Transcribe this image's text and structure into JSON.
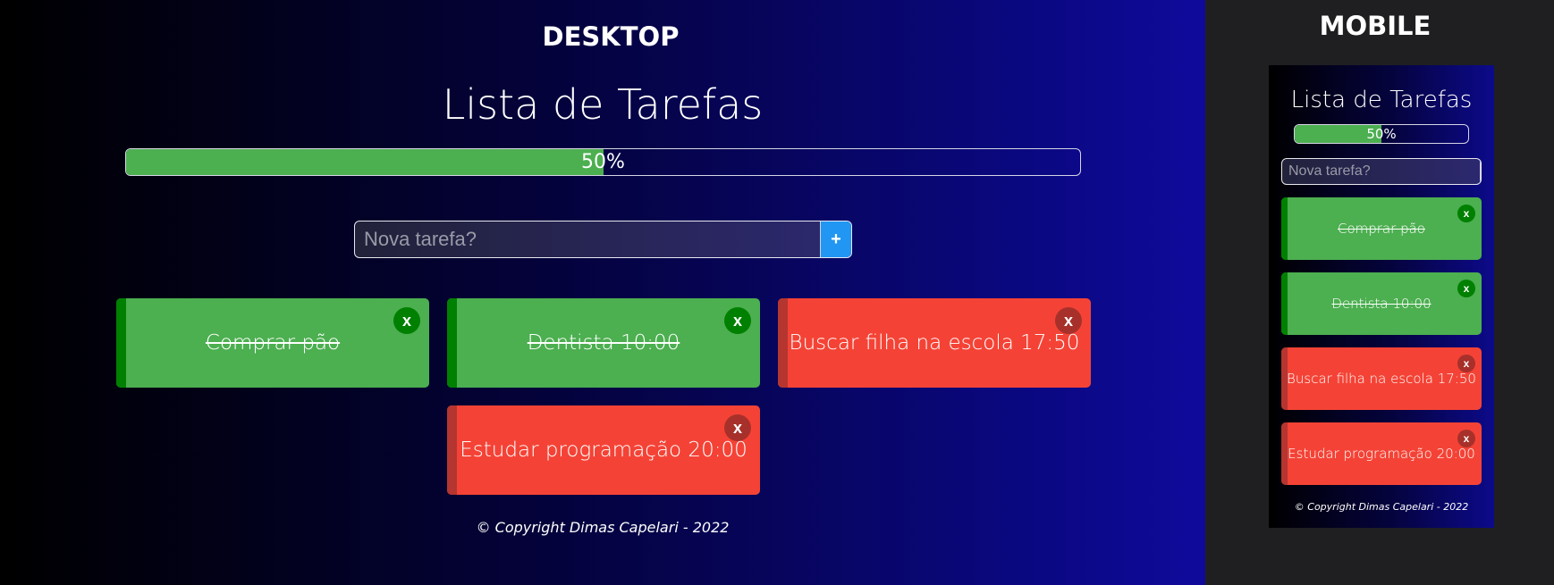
{
  "sections": {
    "desktop": "DESKTOP",
    "mobile": "MOBILE"
  },
  "app": {
    "title": "Lista de Tarefas",
    "progress_value": 0.5,
    "progress_label": "50%",
    "input_placeholder": "Nova tarefa?",
    "add_label": "+",
    "delete_label": "x",
    "copyright": "© Copyright Dimas Capelari - 2022"
  },
  "tasks": [
    {
      "text": "Comprar pão",
      "done": true
    },
    {
      "text": "Dentista 10:00",
      "done": true
    },
    {
      "text": "Buscar filha na escola 17:50",
      "done": false
    },
    {
      "text": "Estudar programação 20:00",
      "done": false
    }
  ],
  "colors": {
    "done": "#4caf50",
    "done_accent": "#008000",
    "todo": "#f44336",
    "todo_accent": "#b53530",
    "add_button": "#2196f3"
  }
}
